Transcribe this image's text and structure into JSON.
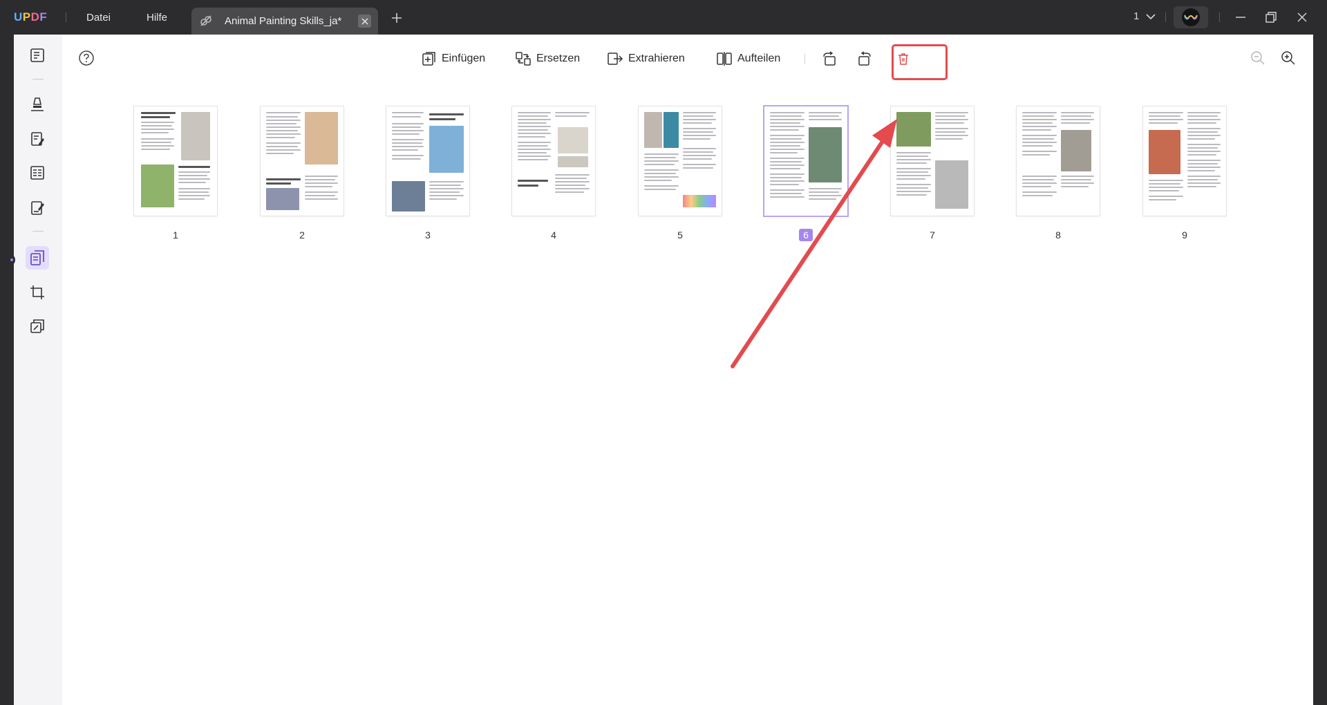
{
  "app": {
    "logo": "UPDF"
  },
  "menu": {
    "file": "Datei",
    "help": "Hilfe"
  },
  "tab": {
    "title": "Animal Painting Skills_ja*"
  },
  "header": {
    "page_indicator": "1"
  },
  "toolbar": {
    "insert": "Einfügen",
    "replace": "Ersetzen",
    "extract": "Extrahieren",
    "split": "Aufteilen"
  },
  "pages": [
    {
      "number": "1"
    },
    {
      "number": "2"
    },
    {
      "number": "3"
    },
    {
      "number": "4"
    },
    {
      "number": "5"
    },
    {
      "number": "6"
    },
    {
      "number": "7"
    },
    {
      "number": "8"
    },
    {
      "number": "9"
    }
  ],
  "selected_page": 6,
  "colors": {
    "accent": "#a585ee",
    "highlight": "#e44a4e",
    "titlebar": "#2c2c2e"
  }
}
